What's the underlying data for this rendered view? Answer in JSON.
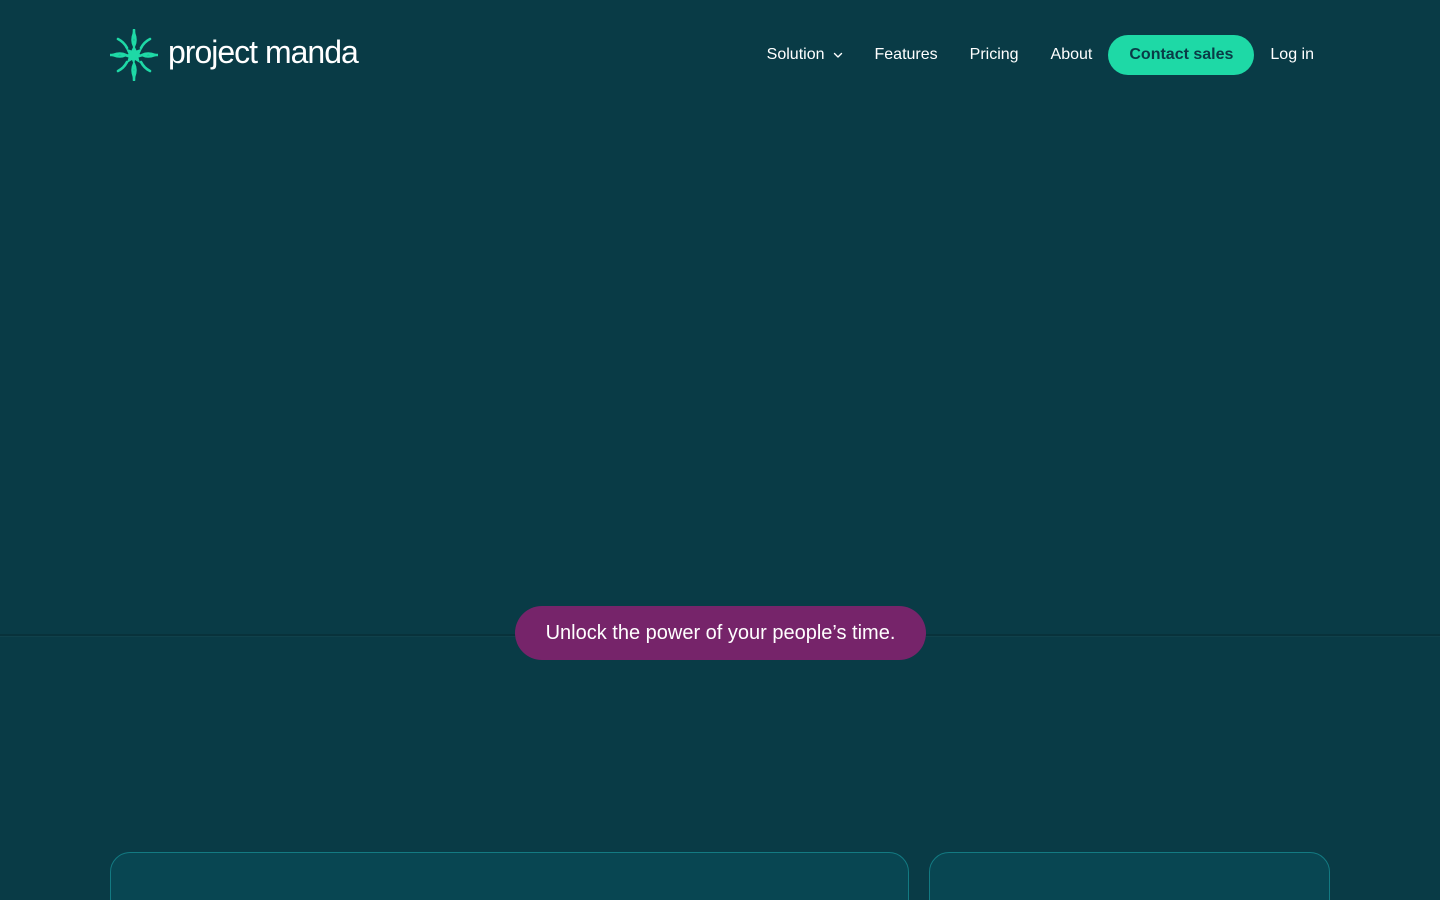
{
  "brand": {
    "name": "project manda",
    "logo_icon": "manda-starburst-icon",
    "accent_color": "#1ed9a6",
    "background_color": "#093b46"
  },
  "nav": {
    "items": [
      {
        "label": "Solution",
        "has_dropdown": true
      },
      {
        "label": "Features"
      },
      {
        "label": "Pricing"
      },
      {
        "label": "About"
      }
    ],
    "cta_label": "Contact sales",
    "login_label": "Log in"
  },
  "hero": {
    "tagline": "Unlock the power of your people’s time.",
    "tagline_color": "#76246a"
  }
}
